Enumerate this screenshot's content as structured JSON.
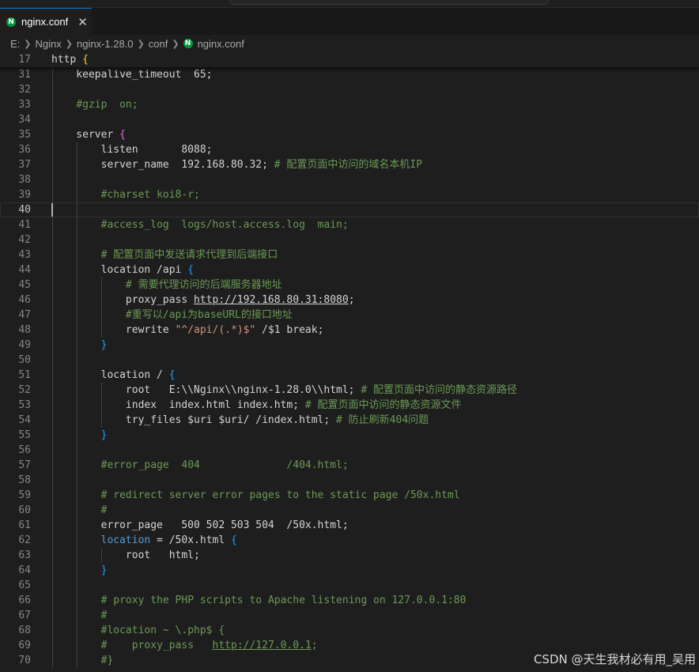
{
  "tab": {
    "label": "nginx.conf",
    "icon": "nginx-file-icon",
    "close": "✕"
  },
  "breadcrumb": [
    "E:",
    "Nginx",
    "nginx-1.28.0",
    "conf",
    "nginx.conf"
  ],
  "sticky": {
    "number": "17",
    "segments": [
      [
        "http ",
        "kw"
      ],
      [
        "{",
        "brace"
      ]
    ]
  },
  "current_line": "40",
  "lines": [
    {
      "n": "31",
      "segs": [
        [
          "    keepalive_timeout  65;",
          ""
        ]
      ]
    },
    {
      "n": "32",
      "segs": []
    },
    {
      "n": "33",
      "segs": [
        [
          "    ",
          ""
        ],
        [
          "#gzip  on;",
          "cm"
        ]
      ]
    },
    {
      "n": "34",
      "segs": []
    },
    {
      "n": "35",
      "segs": [
        [
          "    server ",
          ""
        ],
        [
          "{",
          "b2"
        ]
      ]
    },
    {
      "n": "36",
      "segs": [
        [
          "        listen       8088;",
          ""
        ]
      ]
    },
    {
      "n": "37",
      "segs": [
        [
          "        server_name  192.168.80.32; ",
          ""
        ],
        [
          "# 配置页面中访问的域名本机IP",
          "cm"
        ]
      ]
    },
    {
      "n": "38",
      "segs": []
    },
    {
      "n": "39",
      "segs": [
        [
          "        ",
          ""
        ],
        [
          "#charset koi8-r;",
          "cm"
        ]
      ]
    },
    {
      "n": "40",
      "segs": []
    },
    {
      "n": "41",
      "segs": [
        [
          "        ",
          ""
        ],
        [
          "#access_log  logs/host.access.log  main;",
          "cm"
        ]
      ]
    },
    {
      "n": "42",
      "segs": []
    },
    {
      "n": "43",
      "segs": [
        [
          "        ",
          ""
        ],
        [
          "# 配置页面中发送请求代理到后端接口",
          "cm"
        ]
      ]
    },
    {
      "n": "44",
      "segs": [
        [
          "        location /api ",
          ""
        ],
        [
          "{",
          "b3"
        ]
      ]
    },
    {
      "n": "45",
      "segs": [
        [
          "            ",
          ""
        ],
        [
          "# 需要代理访问的后端服务器地址",
          "cm"
        ]
      ]
    },
    {
      "n": "46",
      "segs": [
        [
          "            proxy_pass ",
          ""
        ],
        [
          "http://192.168.80.31:8080",
          "ul"
        ],
        [
          ";",
          ""
        ]
      ]
    },
    {
      "n": "47",
      "segs": [
        [
          "            ",
          ""
        ],
        [
          "#重写以/api为baseURL的接口地址",
          "cm"
        ]
      ]
    },
    {
      "n": "48",
      "segs": [
        [
          "            rewrite ",
          ""
        ],
        [
          "\"^/api/(.*)$\"",
          "str"
        ],
        [
          " /$1 break;",
          ""
        ]
      ]
    },
    {
      "n": "49",
      "segs": [
        [
          "        ",
          ""
        ],
        [
          "}",
          "b3"
        ]
      ]
    },
    {
      "n": "50",
      "segs": []
    },
    {
      "n": "51",
      "segs": [
        [
          "        location / ",
          ""
        ],
        [
          "{",
          "b3"
        ]
      ]
    },
    {
      "n": "52",
      "segs": [
        [
          "            root   E:\\\\Nginx\\\\nginx-1.28.0\\\\html; ",
          ""
        ],
        [
          "# 配置页面中访问的静态资源路径",
          "cm"
        ]
      ]
    },
    {
      "n": "53",
      "segs": [
        [
          "            index  index.html index.htm; ",
          ""
        ],
        [
          "# 配置页面中访问的静态资源文件",
          "cm"
        ]
      ]
    },
    {
      "n": "54",
      "segs": [
        [
          "            try_files $uri $uri/ /index.html; ",
          ""
        ],
        [
          "# 防止刷新404问题",
          "cm"
        ]
      ]
    },
    {
      "n": "55",
      "segs": [
        [
          "        ",
          ""
        ],
        [
          "}",
          "b3"
        ]
      ]
    },
    {
      "n": "56",
      "segs": []
    },
    {
      "n": "57",
      "segs": [
        [
          "        ",
          ""
        ],
        [
          "#error_page  404              /404.html;",
          "cm"
        ]
      ]
    },
    {
      "n": "58",
      "segs": []
    },
    {
      "n": "59",
      "segs": [
        [
          "        ",
          ""
        ],
        [
          "# redirect server error pages to the static page /50x.html",
          "cm"
        ]
      ]
    },
    {
      "n": "60",
      "segs": [
        [
          "        ",
          ""
        ],
        [
          "#",
          "cm"
        ]
      ]
    },
    {
      "n": "61",
      "segs": [
        [
          "        error_page   500 502 503 504  /50x.html;",
          ""
        ]
      ]
    },
    {
      "n": "62",
      "segs": [
        [
          "        ",
          ""
        ],
        [
          "location",
          "blue"
        ],
        [
          " = /50x.html ",
          ""
        ],
        [
          "{",
          "b3"
        ]
      ]
    },
    {
      "n": "63",
      "segs": [
        [
          "            root   html;",
          ""
        ]
      ]
    },
    {
      "n": "64",
      "segs": [
        [
          "        ",
          ""
        ],
        [
          "}",
          "b3"
        ]
      ]
    },
    {
      "n": "65",
      "segs": []
    },
    {
      "n": "66",
      "segs": [
        [
          "        ",
          ""
        ],
        [
          "# proxy the PHP scripts to Apache listening on 127.0.0.1:80",
          "cm"
        ]
      ]
    },
    {
      "n": "67",
      "segs": [
        [
          "        ",
          ""
        ],
        [
          "#",
          "cm"
        ]
      ]
    },
    {
      "n": "68",
      "segs": [
        [
          "        ",
          ""
        ],
        [
          "#location ~ \\.php$ {",
          "cm"
        ]
      ]
    },
    {
      "n": "69",
      "segs": [
        [
          "        ",
          ""
        ],
        [
          "#    proxy_pass   ",
          "cm"
        ],
        [
          "http://127.0.0.1",
          "cm ul"
        ],
        [
          ";",
          "cm"
        ]
      ]
    },
    {
      "n": "70",
      "segs": [
        [
          "        ",
          ""
        ],
        [
          "#}",
          "cm"
        ]
      ]
    }
  ],
  "colors": {
    "background": "#1e1e1e",
    "comment": "#6a9955",
    "string": "#ce9178",
    "keyword_blue": "#569cd6",
    "brace_gold": "#ffd700",
    "brace_magenta": "#da70d6",
    "brace_blue": "#179fff"
  },
  "watermark": "CSDN @天生我材必有用_吴用"
}
